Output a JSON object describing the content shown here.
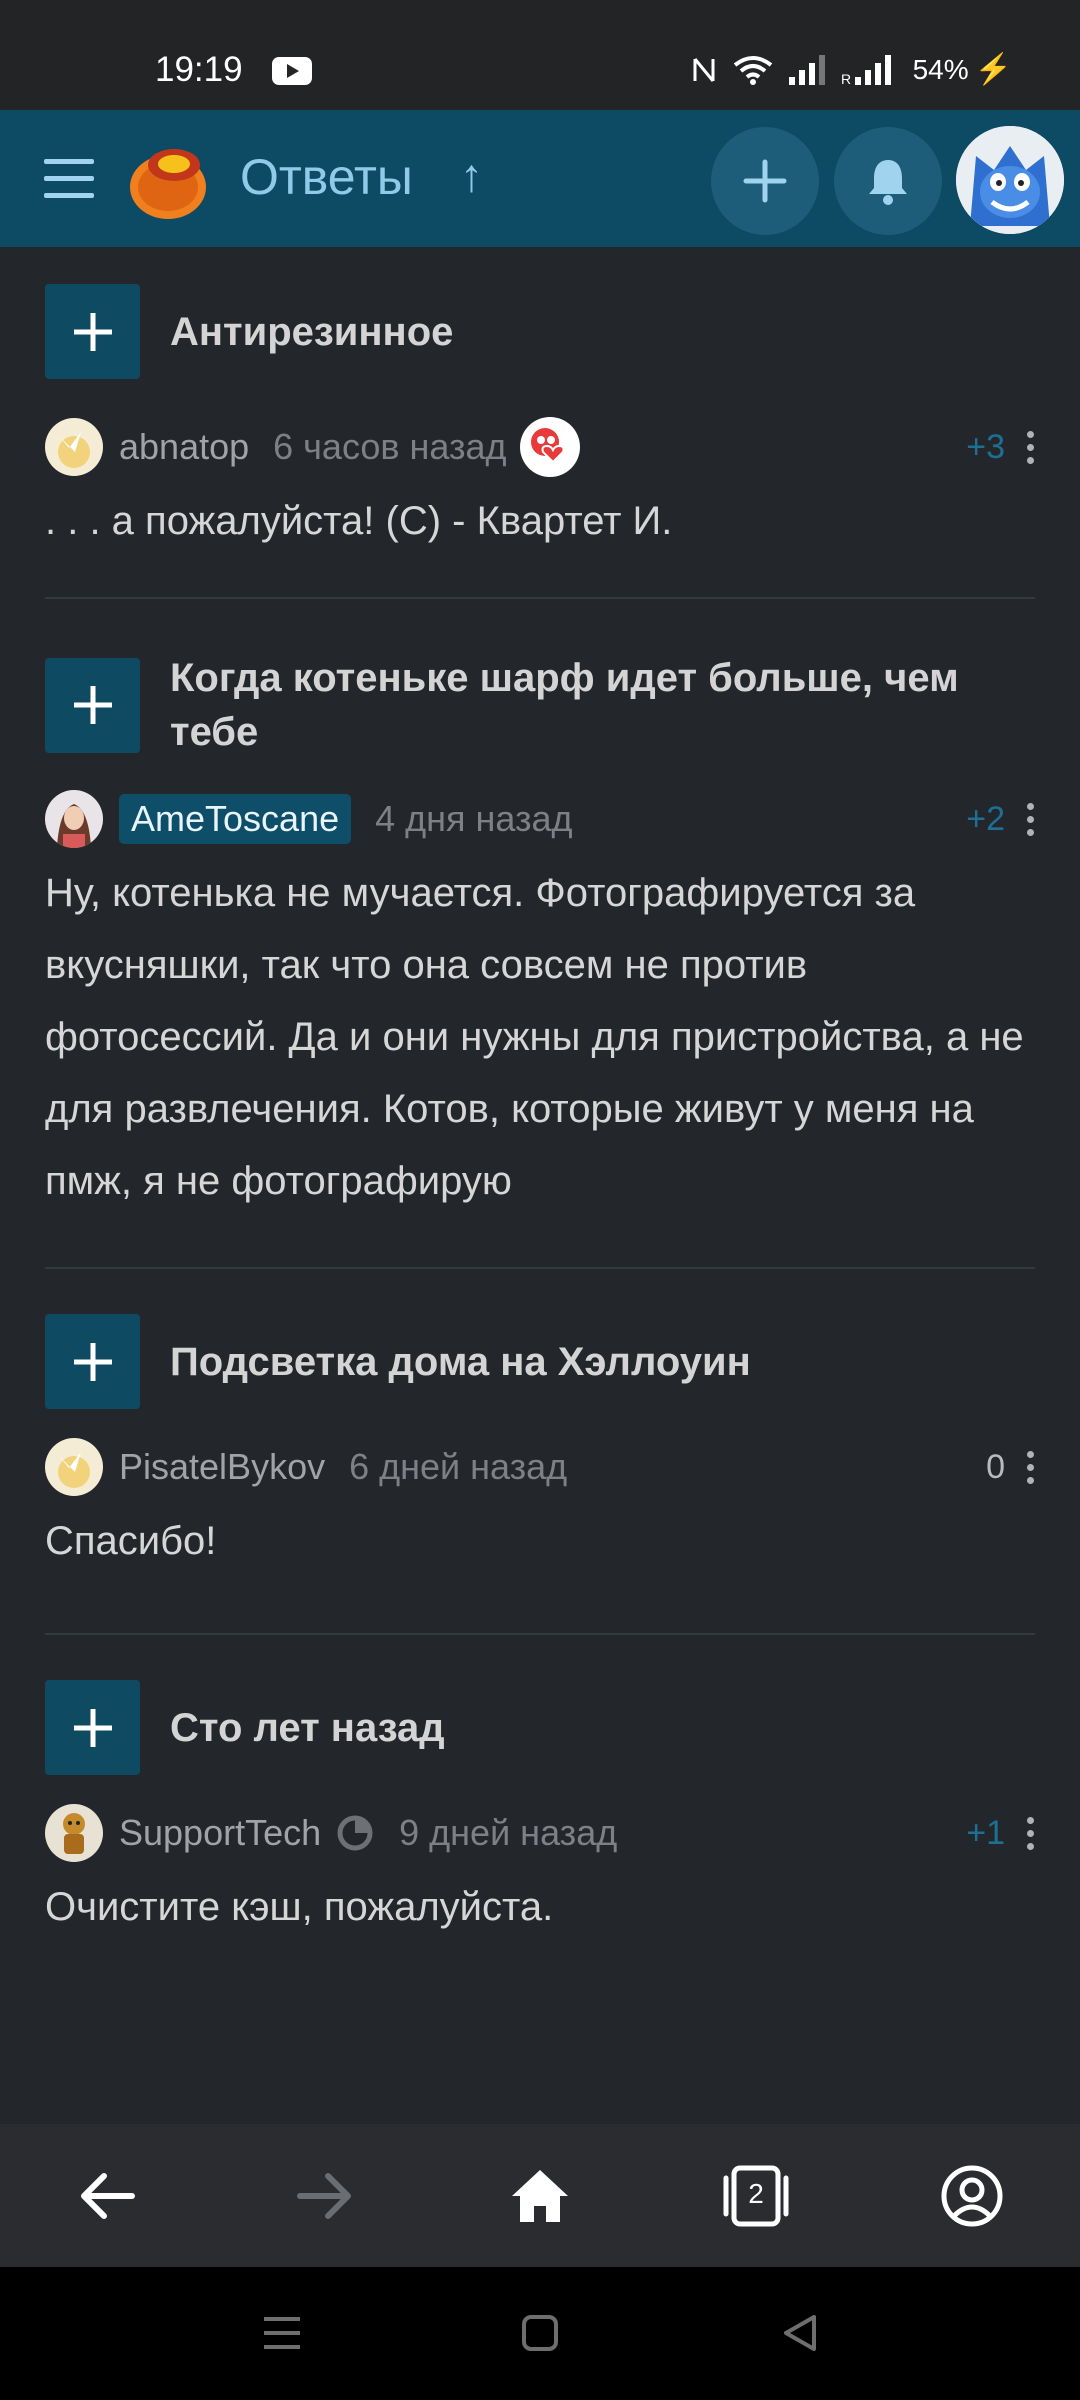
{
  "status_bar": {
    "time": "19:19",
    "battery": "54%",
    "bolt": "⚡"
  },
  "app_bar": {
    "title": "Ответы",
    "arrow": "↑"
  },
  "posts": [
    {
      "question": "Антирезинное",
      "user": "abnatop",
      "time": "6 часов назад",
      "score": "+3",
      "answer": ". . . а пожалуйста! (С) - Квартет И."
    },
    {
      "question": "Когда котеньке шарф идет больше, чем тебе",
      "user": "AmeToscane",
      "time": "4 дня назад",
      "score": "+2",
      "answer": "Ну, котенька не мучается. Фотографируется за вкусняшки, так что она совсем не против фотосессий. Да и они нужны для пристройства, а не для развлечения. Котов, которые живут у меня на пмж, я не фотографирую"
    },
    {
      "question": "Подсветка дома на Хэллоуин",
      "user": "PisatelBykov",
      "time": "6 дней назад",
      "score": "0",
      "answer": "Спасибо!"
    },
    {
      "question": "Сто лет назад",
      "user": "SupportTech",
      "time": "9 дней назад",
      "score": "+1",
      "answer": "Очистите кэш, пожалуйста."
    }
  ],
  "browser_nav": {
    "tab_count": "2"
  },
  "icons": {
    "menu": "menu-icon",
    "logo": "app-logo-icon",
    "plus": "plus-icon",
    "bell": "bell-icon",
    "back": "arrow-left-icon",
    "forward": "arrow-right-icon",
    "home": "home-icon",
    "tabs": "tabs-icon",
    "profile": "profile-icon"
  },
  "colors": {
    "accent": "#0d4a63",
    "background": "#23272b",
    "score": "#1d6f93"
  }
}
